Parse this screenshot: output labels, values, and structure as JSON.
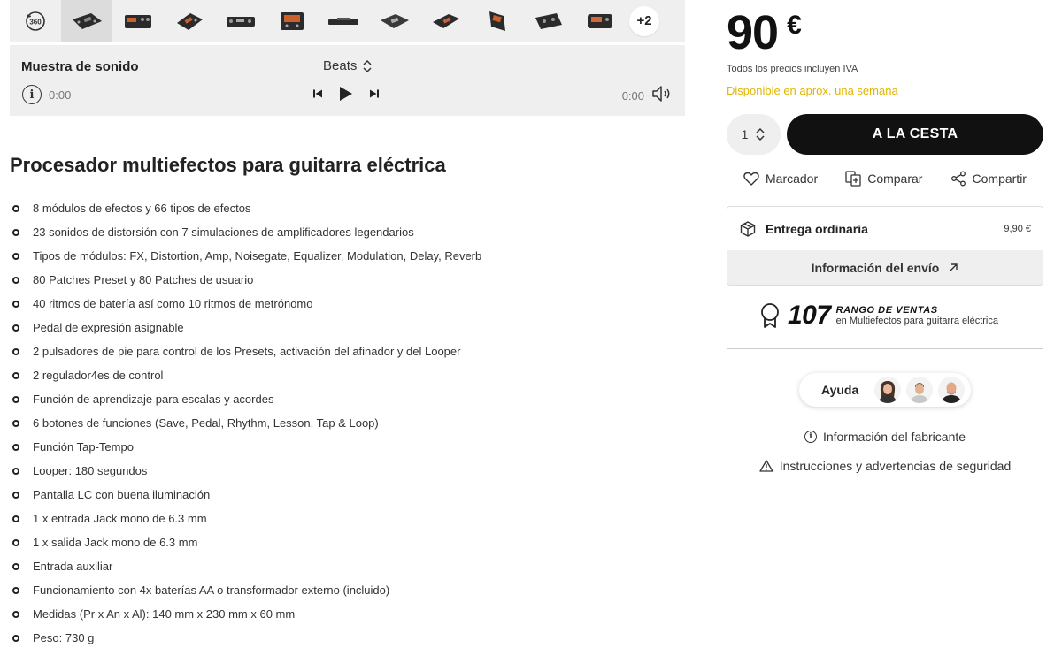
{
  "gallery": {
    "view_360_label": "360",
    "thumbnails": [
      "pedal-1",
      "pedal-2",
      "pedal-3",
      "pedal-4",
      "pedal-5",
      "pedal-6",
      "pedal-7",
      "pedal-8",
      "pedal-9",
      "pedal-10",
      "pedal-11",
      "pedal-12"
    ],
    "more_count": "+2"
  },
  "sound_sample": {
    "title": "Muestra de sonido",
    "selected_style": "Beats",
    "current_time": "0:00",
    "total_time": "0:00"
  },
  "product": {
    "title": "Procesador multiefectos para guitarra eléctrica",
    "features": [
      "8 módulos de efectos y 66 tipos de efectos",
      "23 sonidos de distorsión con 7 simulaciones de amplificadores legendarios",
      "Tipos de módulos: FX, Distortion, Amp, Noisegate, Equalizer, Modulation, Delay, Reverb",
      "80 Patches Preset y 80 Patches de usuario",
      "40 ritmos de batería así como 10 ritmos de metrónomo",
      "Pedal de expresión asignable",
      "2 pulsadores de pie para control de los Presets, activación del afinador y del Looper",
      "2 regulador4es de control",
      "Función de aprendizaje para escalas y acordes",
      "6 botones de funciones (Save, Pedal, Rhythm, Lesson, Tap & Loop)",
      "Función Tap-Tempo",
      "Looper: 180 segundos",
      "Pantalla LC con buena iluminación",
      "1 x entrada Jack mono de 6.3 mm",
      "1 x salida Jack mono de 6.3 mm",
      "Entrada auxiliar",
      "Funcionamiento con 4x baterías AA o transformador externo (incluido)",
      "Medidas (Pr x An x Al): 140 mm x 230 mm x 60 mm",
      "Peso: 730 g"
    ]
  },
  "purchase": {
    "price": "90",
    "currency": "€",
    "vat_note": "Todos los precios incluyen IVA",
    "availability": "Disponible en aprox. una semana",
    "availability_color": "#e2b500",
    "quantity": "1",
    "add_to_cart": "A LA CESTA"
  },
  "actions": {
    "bookmark": "Marcador",
    "compare": "Comparar",
    "share": "Compartir"
  },
  "delivery": {
    "label": "Entrega ordinaria",
    "cost": "9,90 €",
    "shipping_info": "Información del envío"
  },
  "ranking": {
    "number": "107",
    "label": "RANGO DE VENTAS",
    "category": "en Multiefectos para guitarra eléctrica"
  },
  "help": {
    "label": "Ayuda"
  },
  "links": {
    "manufacturer_info": "Información del fabricante",
    "safety_instructions": "Instrucciones y advertencias de seguridad"
  }
}
